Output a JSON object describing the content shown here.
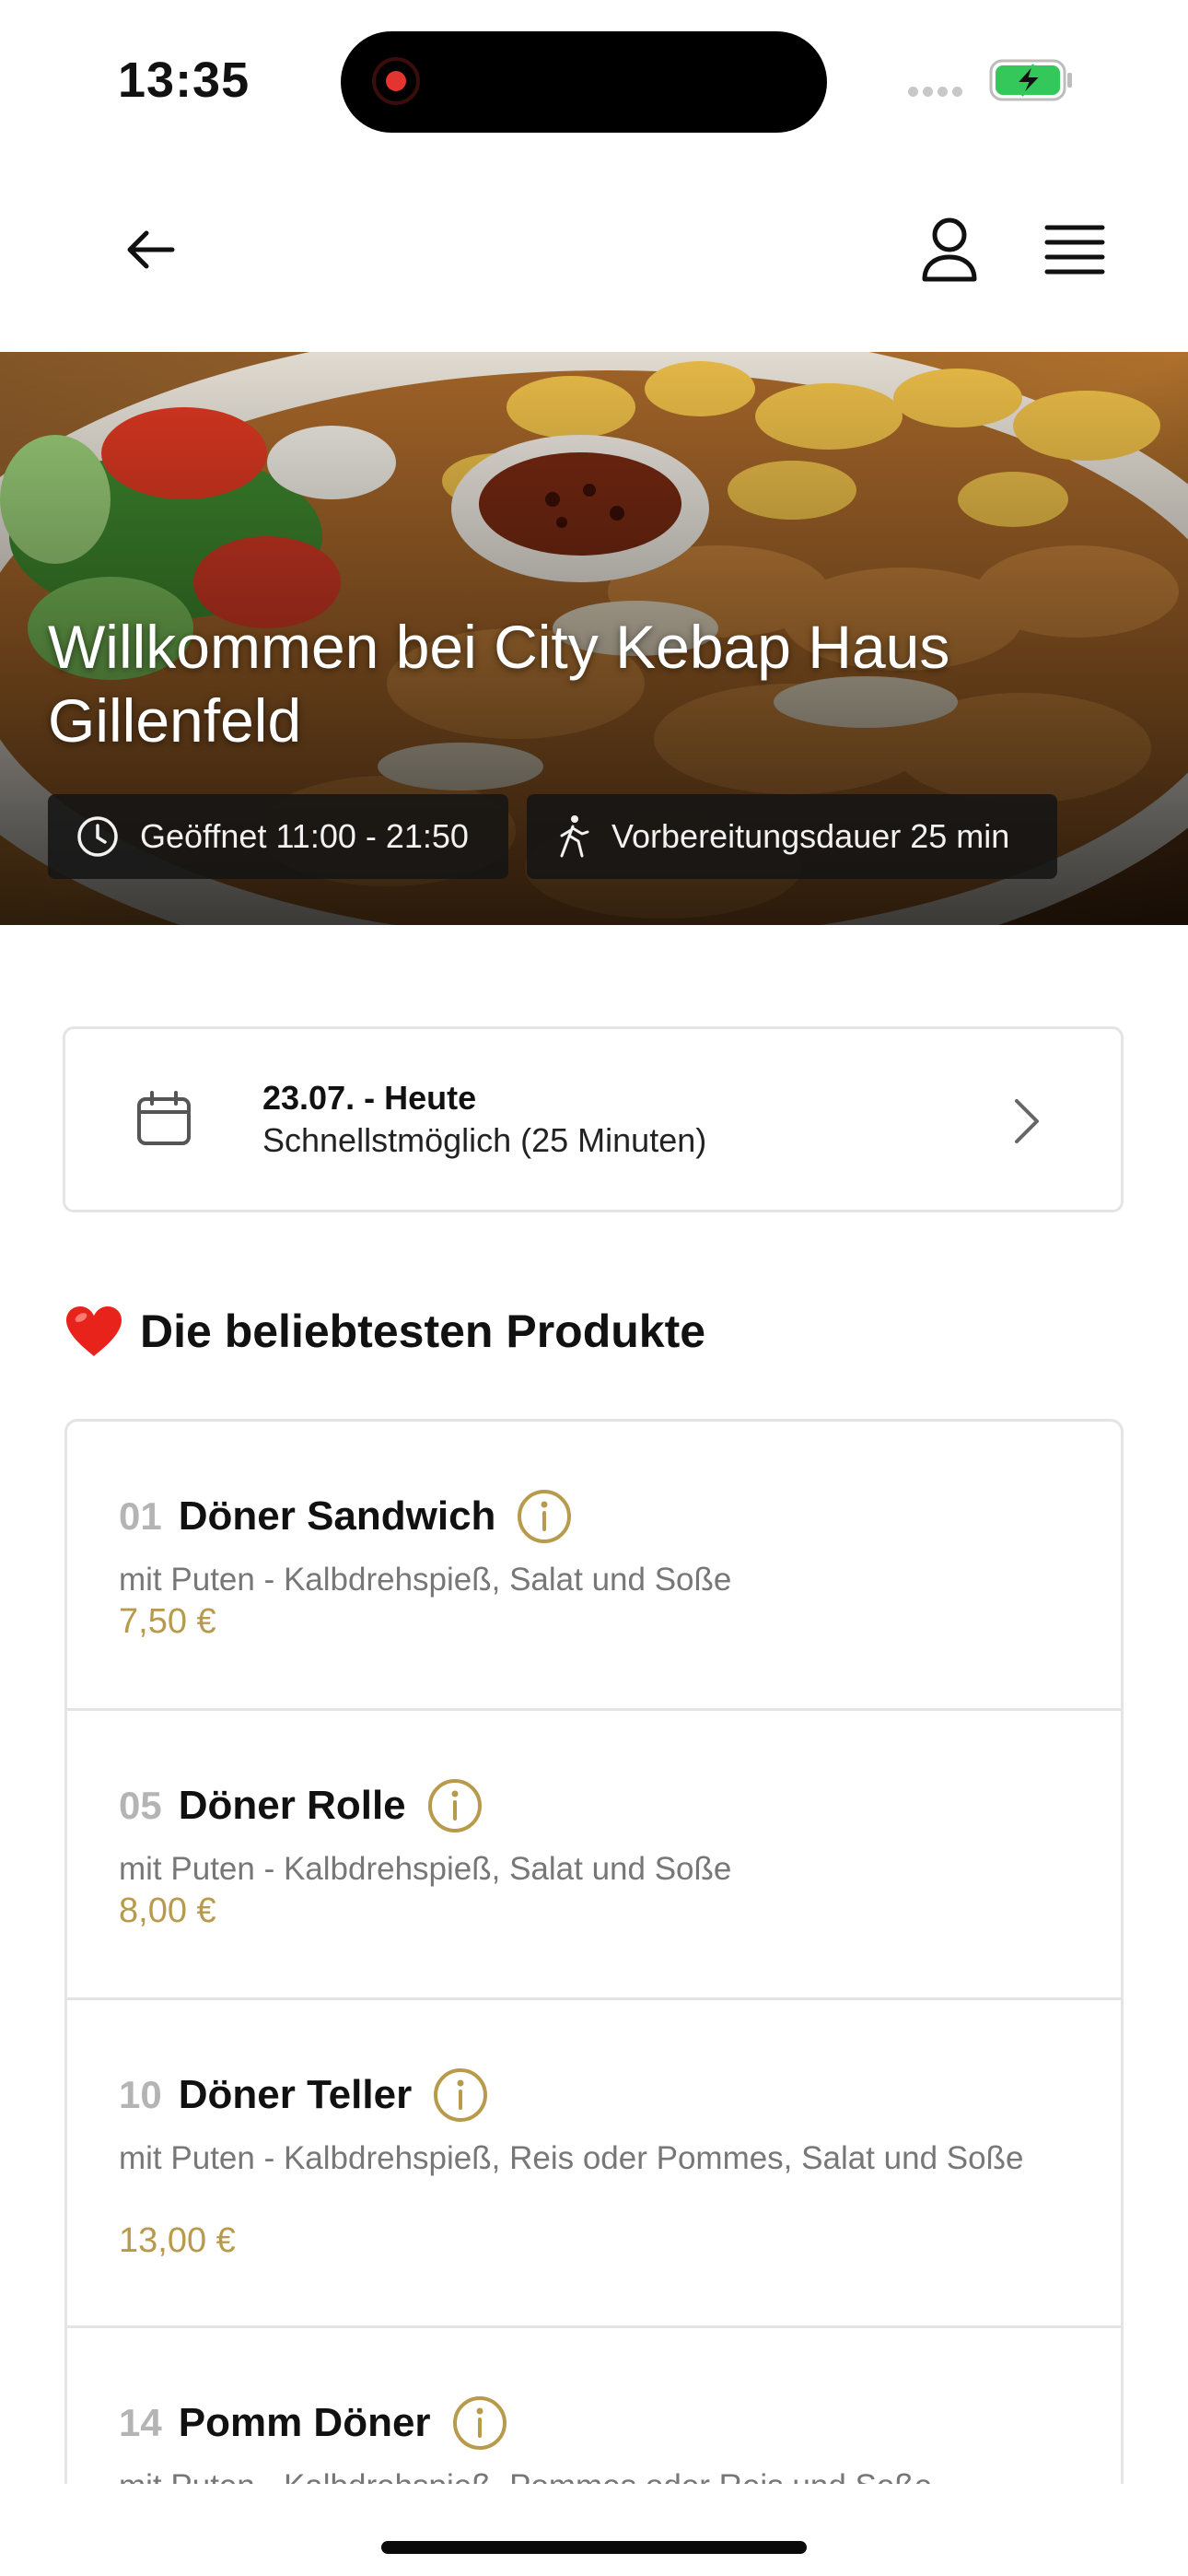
{
  "status": {
    "time": "13:35"
  },
  "hero": {
    "title": "Willkommen bei City Kebap Haus Gillenfeld",
    "open_hours": "Geöffnet 11:00 - 21:50",
    "prep_time": "Vorbereitungsdauer 25 min"
  },
  "date_picker": {
    "title": "23.07. - Heute",
    "subtitle": "Schnellstmöglich (25 Minuten)"
  },
  "popular": {
    "heading": "Die beliebtesten Produkte",
    "items": [
      {
        "number": "01",
        "name": "Döner Sandwich",
        "description": "mit Puten - Kalbdrehspieß, Salat und Soße",
        "price": "7,50 €"
      },
      {
        "number": "05",
        "name": "Döner Rolle",
        "description": "mit Puten - Kalbdrehspieß, Salat und Soße",
        "price": "8,00 €"
      },
      {
        "number": "10",
        "name": "Döner Teller",
        "description": "mit Puten - Kalbdrehspieß, Reis oder Pommes, Salat und Soße",
        "price": "13,00 €"
      },
      {
        "number": "14",
        "name": "Pomm Döner",
        "description": "mit Puten - Kalbdrehspieß, Pommes oder Reis und Soße",
        "price": ""
      }
    ]
  },
  "colors": {
    "accent": "#b79a4c",
    "border": "#e4e4e4",
    "battery": "#34c759"
  },
  "icons": [
    "back-arrow-icon",
    "user-icon",
    "menu-icon",
    "clock-icon",
    "walking-icon",
    "calendar-icon",
    "chevron-right-icon",
    "heart-icon",
    "info-icon"
  ]
}
